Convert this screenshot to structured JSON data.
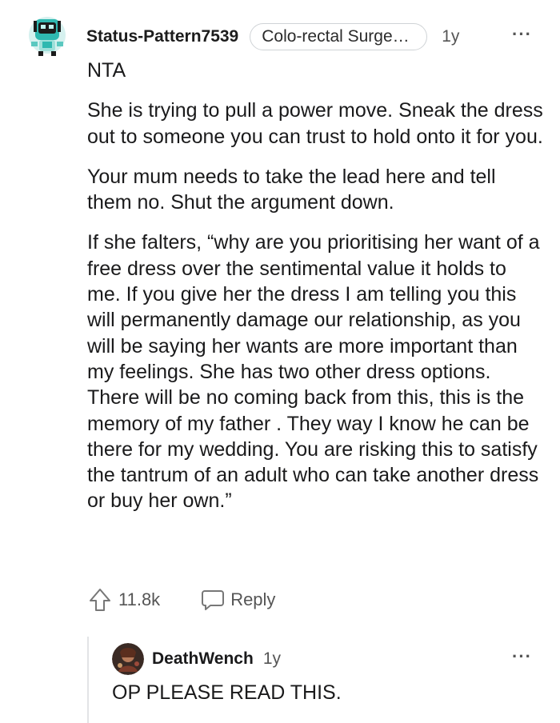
{
  "comment": {
    "username": "Status-Pattern7539",
    "flair": "Colo-rectal Surgeo...",
    "age": "1y",
    "more_icon": "···",
    "paragraphs": [
      "NTA",
      "She is trying to pull a power move. Sneak the dress out to someone you can trust to hold onto it for you.",
      "Your mum needs to take the lead here and tell them no. Shut the argument down.",
      "If she falters, “why are you prioritising her want of a free dress over the sentimental value it holds to me. If you give her the dress I am telling you this will permanently damage our relationship, as you will be saying her wants are more important than my feelings. She has two other dress options. There will be no coming back from this, this is the memory of my father . They way I know he can be there for my wedding. You are risking this to satisfy the tantrum of an adult who can take another dress or buy her own.”"
    ],
    "score": "11.8k",
    "reply_label": "Reply"
  },
  "reply": {
    "username": "DeathWench",
    "age": "1y",
    "more_icon": "···",
    "text": "OP PLEASE READ THIS."
  },
  "colors": {
    "text": "#1a1a1b",
    "muted": "#555555",
    "flair_border": "#cfd3d6",
    "thread_line": "#e2e4e6",
    "avatar_teal": "#2fb8b0"
  },
  "icons": {
    "avatar": "snoo-avatar-icon",
    "upvote": "upvote-arrow-icon",
    "reply": "speech-bubble-icon",
    "more": "overflow-menu-icon"
  }
}
